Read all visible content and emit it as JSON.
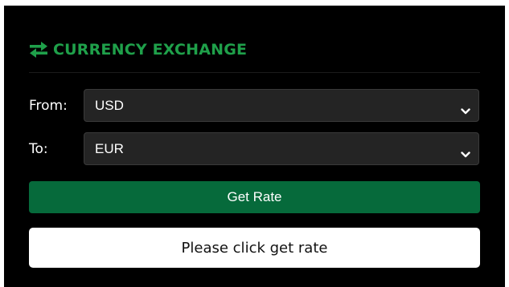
{
  "header": {
    "title": "CURRENCY EXCHANGE",
    "icon": "exchange-arrows-icon",
    "accent_color": "#1fa04a"
  },
  "form": {
    "from_label": "From:",
    "from_value": "USD",
    "to_label": "To:",
    "to_value": "EUR"
  },
  "actions": {
    "get_rate_label": "Get Rate",
    "button_color": "#066a3b"
  },
  "result": {
    "text": "Please click get rate"
  }
}
